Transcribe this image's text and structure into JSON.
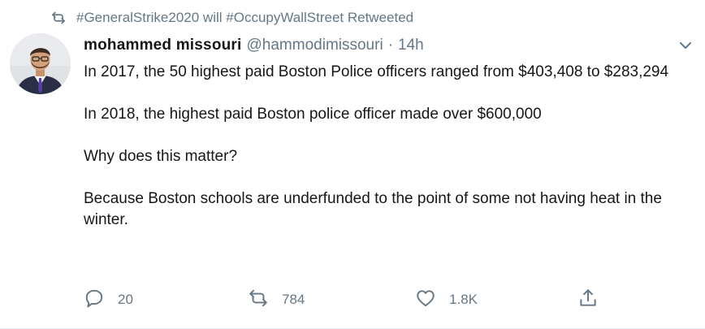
{
  "retweet_context": {
    "text": "#GeneralStrike2020 will #OccupyWallStreet Retweeted",
    "icon": "retweet-icon"
  },
  "author": {
    "name": "mohammed missouri",
    "handle": "@hammodimissouri",
    "separator": "·",
    "time": "14h"
  },
  "tweet": {
    "paragraphs": [
      "In 2017, the 50 highest paid Boston Police officers ranged from $403,408 to $283,294",
      "In 2018, the highest paid Boston police officer made over $600,000",
      "Why does this matter?",
      "Because Boston schools are underfunded to the point of some not having heat in the winter."
    ]
  },
  "actions": {
    "reply": {
      "icon": "reply-icon",
      "count": "20"
    },
    "retweet": {
      "icon": "retweet-icon",
      "count": "784"
    },
    "like": {
      "icon": "heart-icon",
      "count": "1.8K"
    },
    "share": {
      "icon": "share-icon"
    }
  },
  "colors": {
    "text_primary": "#14171a",
    "text_secondary": "#657786"
  }
}
